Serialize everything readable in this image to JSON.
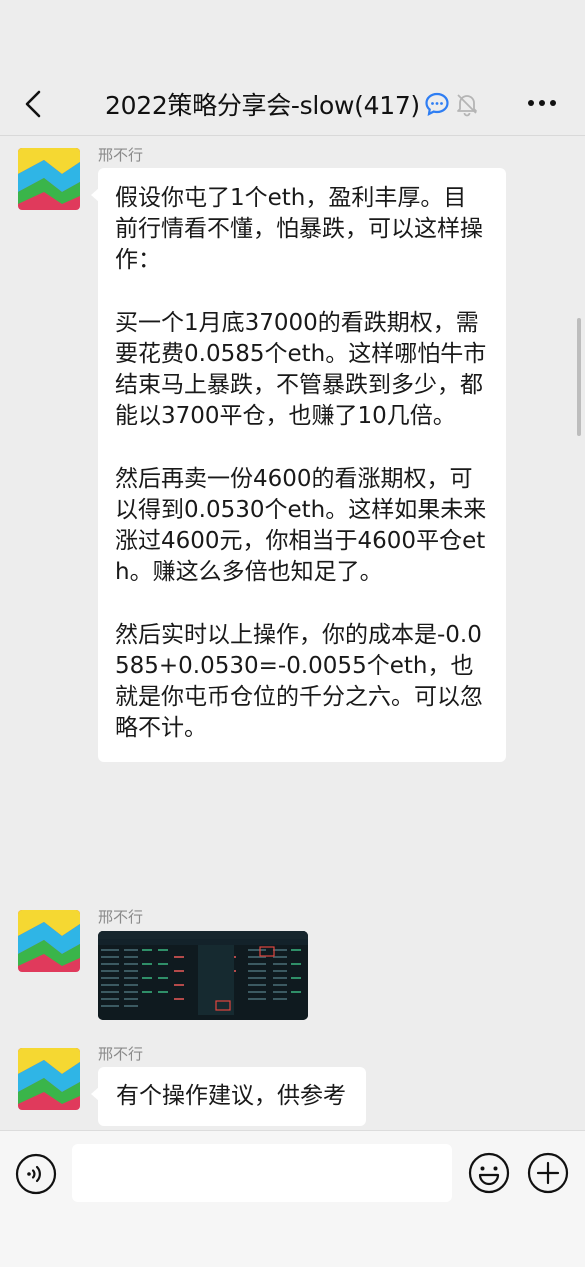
{
  "header": {
    "title": "2022策略分享会-slow(417)",
    "back_icon": "chevron-left-icon",
    "more_icon": "more-dots-icon",
    "chat_icon": "chat-bubble-icon",
    "mute_icon": "bell-mute-icon"
  },
  "messages": [
    {
      "sender": "邢不行",
      "type": "text",
      "text": "假设你屯了1个eth，盈利丰厚。目前行情看不懂，怕暴跌，可以这样操作：\n\n买一个1月底37000的看跌期权，需要花费0.0585个eth。这样哪怕牛市结束马上暴跌，不管暴跌到多少，都能以3700平仓，也赚了10几倍。\n\n然后再卖一份4600的看涨期权，可以得到0.0530个eth。这样如果未来涨过4600元，你相当于4600平仓eth。赚这么多倍也知足了。\n\n然后实时以上操作，你的成本是-0.0585+0.0530=-0.0055个eth，也就是你屯币仓位的千分之六。可以忽略不计。"
    },
    {
      "sender": "邢不行",
      "type": "image",
      "image_desc": "options-chain-screenshot"
    },
    {
      "sender": "邢不行",
      "type": "text",
      "text": "有个操作建议，供参考"
    }
  ],
  "input_bar": {
    "voice_icon": "voice-icon",
    "emoji_icon": "emoji-icon",
    "plus_icon": "plus-icon",
    "input_value": ""
  },
  "colors": {
    "background": "#ededed",
    "bubble": "#ffffff",
    "nick": "#8a8a8a",
    "accent_chat_icon": "#2f7ef3"
  }
}
